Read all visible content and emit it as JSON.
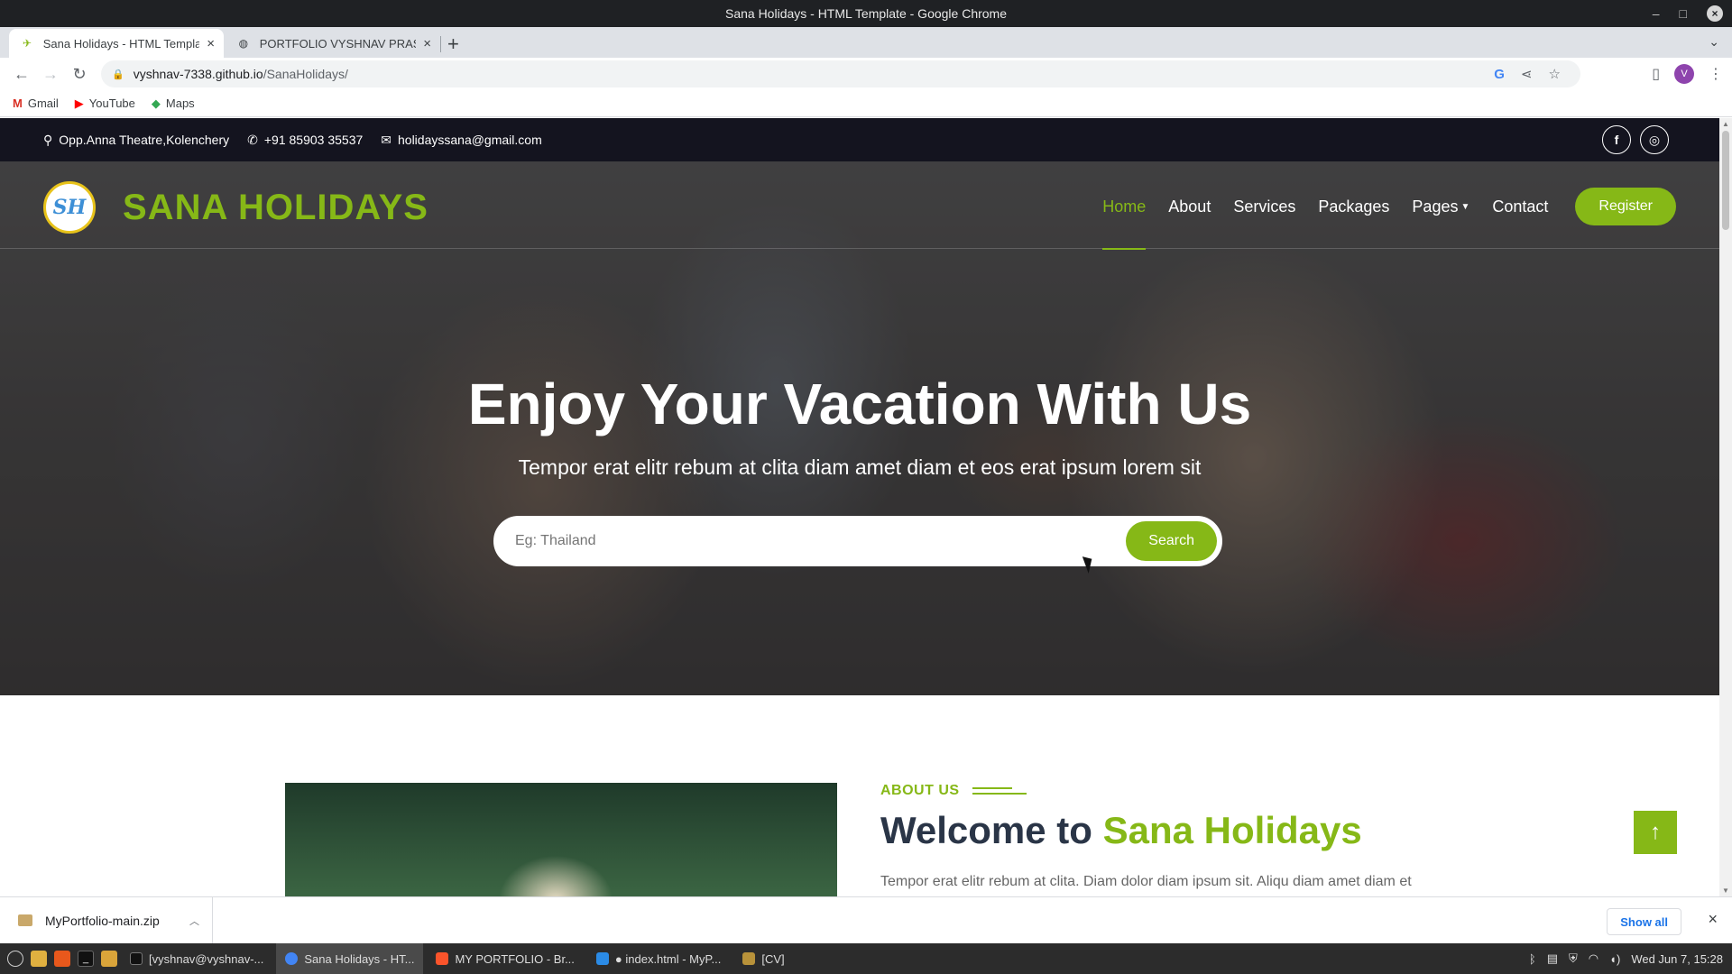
{
  "window": {
    "title": "Sana Holidays - HTML Template - Google Chrome"
  },
  "tabs": [
    {
      "title": "Sana Holidays - HTML Templa",
      "active": true
    },
    {
      "title": "PORTFOLIO VYSHNAV PRAS",
      "active": false
    }
  ],
  "address_bar": {
    "host": "vyshnav-7338.github.io",
    "path": "/SanaHolidays/"
  },
  "profile_initial": "V",
  "bookmarks": [
    {
      "label": "Gmail",
      "icon": "gmail-icon"
    },
    {
      "label": "YouTube",
      "icon": "youtube-icon"
    },
    {
      "label": "Maps",
      "icon": "maps-icon"
    }
  ],
  "topbar": {
    "address": "Opp.Anna Theatre,Kolenchery",
    "phone": "+91 85903 35537",
    "email": "holidayssana@gmail.com",
    "socials": [
      "facebook-icon",
      "instagram-icon"
    ]
  },
  "brand": {
    "name": "SANA HOLIDAYS",
    "color": "#86b817"
  },
  "nav": {
    "items": [
      "Home",
      "About",
      "Services",
      "Packages",
      "Pages",
      "Contact"
    ],
    "active": "Home",
    "register": "Register"
  },
  "hero": {
    "title": "Enjoy Your Vacation With Us",
    "subtitle": "Tempor erat elitr rebum at clita diam amet diam et eos erat ipsum lorem sit",
    "search_placeholder": "Eg: Thailand",
    "search_button": "Search"
  },
  "about": {
    "label": "ABOUT US",
    "title_prefix": "Welcome to",
    "title_accent": "Sana Holidays",
    "text": "Tempor erat elitr rebum at clita. Diam dolor diam ipsum sit. Aliqu diam amet diam et"
  },
  "download": {
    "filename": "MyPortfolio-main.zip",
    "show_all": "Show all"
  },
  "taskbar": {
    "tasks": [
      {
        "label": "[vyshnav@vyshnav-...",
        "active": false
      },
      {
        "label": "Sana Holidays - HT...",
        "active": true
      },
      {
        "label": "MY PORTFOLIO - Br...",
        "active": false
      },
      {
        "label": "● index.html - MyP...",
        "active": false
      },
      {
        "label": "[CV]",
        "active": false
      }
    ],
    "clock": "Wed Jun  7, 15:28"
  }
}
